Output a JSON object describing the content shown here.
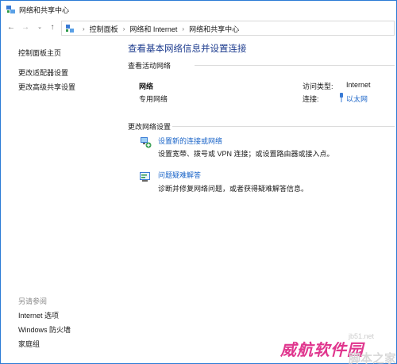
{
  "window": {
    "title": "网络和共享中心"
  },
  "nav": {
    "back": "←",
    "forward": "→",
    "dropdown": "⌄",
    "up": "↑"
  },
  "breadcrumbs": [
    "控制面板",
    "网络和 Internet",
    "网络和共享中心"
  ],
  "breadcrumb_sep": "›",
  "sidebar": {
    "home": "控制面板主页",
    "items": [
      "更改适配器设置",
      "更改高级共享设置"
    ]
  },
  "see_also": {
    "title": "另请参阅",
    "items": [
      "Internet 选项",
      "Windows 防火墙",
      "家庭组"
    ]
  },
  "main": {
    "title": "查看基本网络信息并设置连接",
    "active_header": "查看活动网络",
    "network": {
      "name": "网络",
      "type": "专用网络",
      "access_label": "访问类型:",
      "access_value": "Internet",
      "conn_label": "连接:",
      "conn_value": "以太网"
    },
    "settings_header": "更改网络设置",
    "tasks": [
      {
        "link": "设置新的连接或网络",
        "desc": "设置宽带、拨号或 VPN 连接；或设置路由器或接入点。"
      },
      {
        "link": "问题疑难解答",
        "desc": "诊断并修复网络问题，或者获得疑难解答信息。"
      }
    ]
  },
  "watermark": {
    "main": "威航软件园",
    "url": "jb51.net",
    "sub": "脚本之家"
  },
  "colors": {
    "link": "#1a64c8",
    "title": "#1e3d8f",
    "border": "#2b7bd6",
    "watermark": "#e0368e"
  }
}
